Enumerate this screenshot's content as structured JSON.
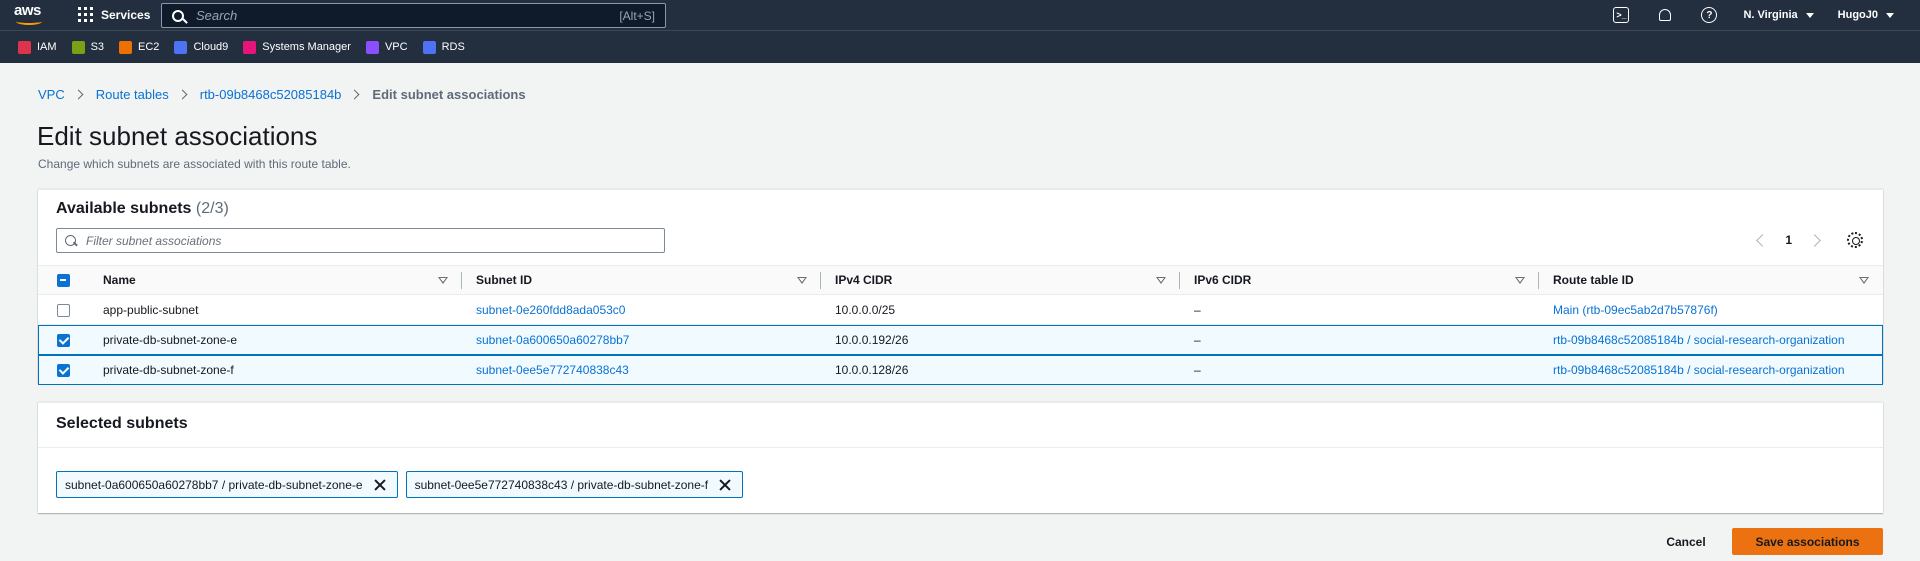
{
  "topnav": {
    "logo_text": "aws",
    "services_label": "Services",
    "search_placeholder": "Search",
    "search_shortcut": "[Alt+S]",
    "region": "N. Virginia",
    "user": "HugoJ0"
  },
  "favorites": [
    {
      "label": "IAM",
      "color": "#dd344c"
    },
    {
      "label": "S3",
      "color": "#7aa116"
    },
    {
      "label": "EC2",
      "color": "#ed7100"
    },
    {
      "label": "Cloud9",
      "color": "#4d72f3"
    },
    {
      "label": "Systems Manager",
      "color": "#e7157b"
    },
    {
      "label": "VPC",
      "color": "#8c4fff"
    },
    {
      "label": "RDS",
      "color": "#4d72f3"
    }
  ],
  "breadcrumb": {
    "vpc": "VPC",
    "route_tables": "Route tables",
    "rtb": "rtb-09b8468c52085184b",
    "current": "Edit subnet associations"
  },
  "page": {
    "title": "Edit subnet associations",
    "description": "Change which subnets are associated with this route table."
  },
  "available": {
    "title": "Available subnets",
    "count": "(2/3)",
    "filter_placeholder": "Filter subnet associations",
    "page_number": "1",
    "columns": [
      "Name",
      "Subnet ID",
      "IPv4 CIDR",
      "IPv6 CIDR",
      "Route table ID"
    ],
    "rows": [
      {
        "checked": false,
        "name": "app-public-subnet",
        "subnet_id": "subnet-0e260fdd8ada053c0",
        "ipv4": "10.0.0.0/25",
        "ipv6": "–",
        "route_table": "Main (rtb-09ec5ab2d7b57876f)"
      },
      {
        "checked": true,
        "name": "private-db-subnet-zone-e",
        "subnet_id": "subnet-0a600650a60278bb7",
        "ipv4": "10.0.0.192/26",
        "ipv6": "–",
        "route_table": "rtb-09b8468c52085184b / social-research-organization"
      },
      {
        "checked": true,
        "name": "private-db-subnet-zone-f",
        "subnet_id": "subnet-0ee5e772740838c43",
        "ipv4": "10.0.0.128/26",
        "ipv6": "–",
        "route_table": "rtb-09b8468c52085184b / social-research-organization"
      }
    ]
  },
  "selected": {
    "title": "Selected subnets",
    "tokens": [
      "subnet-0a600650a60278bb7 / private-db-subnet-zone-e",
      "subnet-0ee5e772740838c43 / private-db-subnet-zone-f"
    ]
  },
  "actions": {
    "cancel": "Cancel",
    "save": "Save associations"
  },
  "colors": {
    "nav_bg": "#232f3e",
    "link": "#0972d3",
    "primary_button": "#ec7211",
    "selected_row": "#f1faff"
  }
}
